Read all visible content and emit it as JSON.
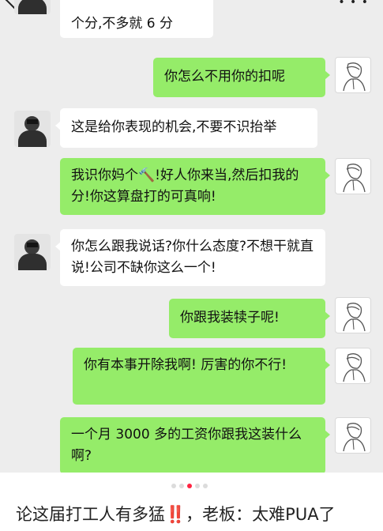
{
  "colors": {
    "chat_background": "#ededed",
    "own_bubble": "#95ec69",
    "other_bubble": "#ffffff",
    "active_page_dot": "#ff2442",
    "caption_emoji": "#e8222b"
  },
  "icons": {
    "back": "chevron-left-icon",
    "more": "more-dots-icon",
    "boss_avatar": "boss-avatar",
    "my_avatar": "sketch-person-avatar"
  },
  "messages": [
    {
      "side": "left",
      "text": "个分,不多就 6 分"
    },
    {
      "side": "right",
      "text": "你怎么不用你的扣呢"
    },
    {
      "side": "left",
      "text": "这是给你表现的机会,不要不识抬举"
    },
    {
      "side": "right",
      "text": "我识你妈个🔨!好人你来当,然后扣我的分!你这算盘打的可真响!"
    },
    {
      "side": "left",
      "text": "你怎么跟我说话?你什么态度?不想干就直说!公司不缺你这么一个!"
    },
    {
      "side": "right",
      "text": "你跟我装犊子呢!"
    },
    {
      "side": "right",
      "text": "你有本事开除我啊!  厉害的你不行!"
    },
    {
      "side": "right",
      "text": "一个月 3000 多的工资你跟我这装什么啊?"
    }
  ],
  "pager": {
    "total": 5,
    "current": 3
  },
  "caption": {
    "text_before": "论这届打工人有多猛",
    "emoji": "‼️",
    "text_after": "，老板：太难PUA了"
  }
}
